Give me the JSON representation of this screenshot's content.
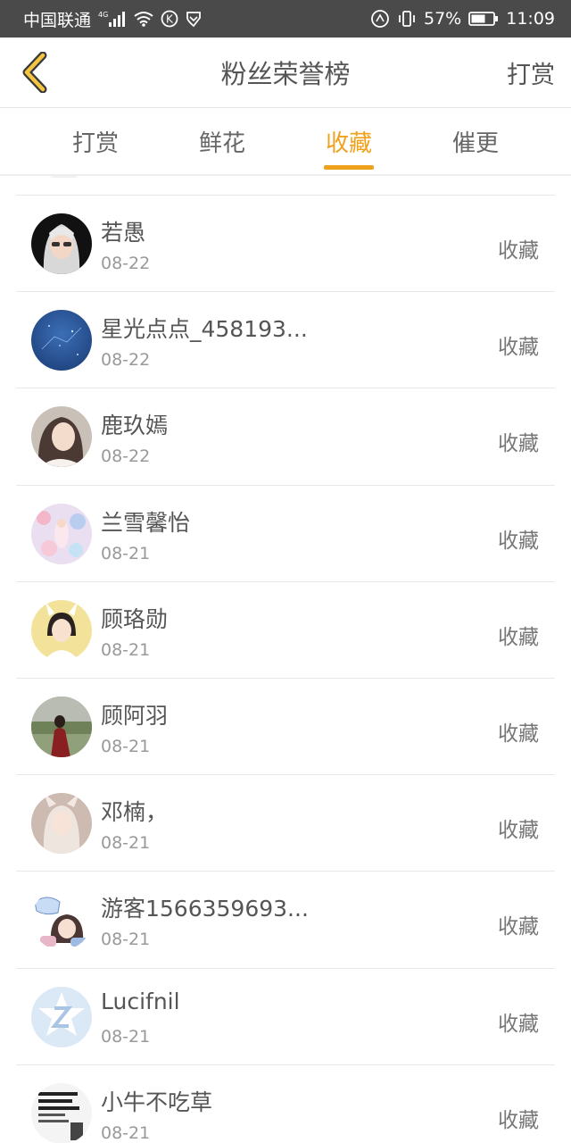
{
  "status_bar": {
    "carrier": "中国联通",
    "network": "4G",
    "battery": "57%",
    "time": "11:09"
  },
  "header": {
    "title": "粉丝荣誉榜",
    "action": "打赏"
  },
  "tabs": [
    {
      "label": "打赏",
      "active": false
    },
    {
      "label": "鲜花",
      "active": false
    },
    {
      "label": "收藏",
      "active": true
    },
    {
      "label": "催更",
      "active": false
    }
  ],
  "list": [
    {
      "name": "若愚",
      "date": "08-22",
      "type": "收藏",
      "avatar": "avatar-silver-hair"
    },
    {
      "name": "星光点点_458193...",
      "date": "08-22",
      "type": "收藏",
      "avatar": "avatar-starry-sky"
    },
    {
      "name": "鹿玖嫣",
      "date": "08-22",
      "type": "收藏",
      "avatar": "avatar-girl-photo"
    },
    {
      "name": "兰雪馨怡",
      "date": "08-21",
      "type": "收藏",
      "avatar": "avatar-floral"
    },
    {
      "name": "顾珞勋",
      "date": "08-21",
      "type": "收藏",
      "avatar": "avatar-anime-bunny"
    },
    {
      "name": "顾阿羽",
      "date": "08-21",
      "type": "收藏",
      "avatar": "avatar-outdoor-girl"
    },
    {
      "name": "邓楠，",
      "date": "08-21",
      "type": "收藏",
      "avatar": "avatar-anime-fox"
    },
    {
      "name": "游客1566359693...",
      "date": "08-21",
      "type": "收藏",
      "avatar": "avatar-chibi"
    },
    {
      "name": "Lucifnil",
      "date": "08-21",
      "type": "收藏",
      "avatar": "avatar-qq-default"
    },
    {
      "name": "小牛不吃草",
      "date": "08-21",
      "type": "收藏",
      "avatar": "avatar-text-image"
    }
  ],
  "colors": {
    "accent": "#f0a11b",
    "status_bar": "#4a4a4a",
    "divider": "#e8e8e8"
  }
}
